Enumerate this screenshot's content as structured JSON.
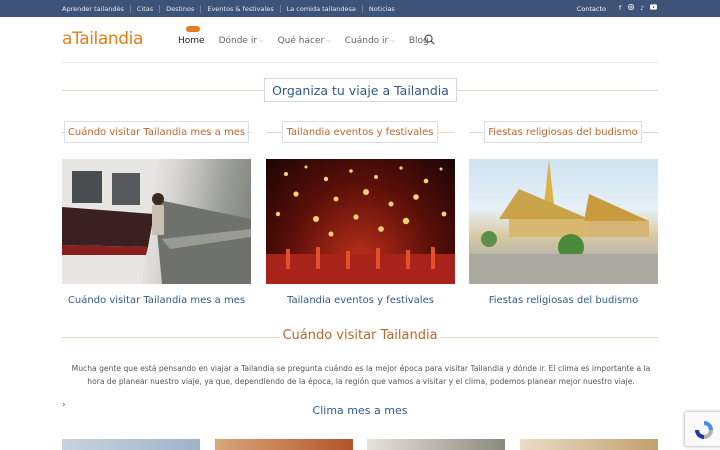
{
  "topbar": {
    "links": [
      "Aprender tailandés",
      "Citas",
      "Destinos",
      "Eventos & festivales",
      "La comida tailandesa",
      "Noticias"
    ],
    "contact": "Contacto",
    "social_icons": [
      "facebook-icon",
      "instagram-icon",
      "tiktok-icon",
      "youtube-icon"
    ]
  },
  "header": {
    "logo": "aTailandia",
    "nav": [
      {
        "label": "Home",
        "dropdown": false,
        "active": true
      },
      {
        "label": "Dónde ir",
        "dropdown": true,
        "active": false
      },
      {
        "label": "Qué hacer",
        "dropdown": true,
        "active": false
      },
      {
        "label": "Cuándo ir",
        "dropdown": true,
        "active": false
      },
      {
        "label": "Blog",
        "dropdown": false,
        "active": false
      }
    ]
  },
  "main": {
    "title": "Organiza tu viaje a Tailandia",
    "categories": [
      {
        "title": "Cuándo visitar Tailandia mes a mes",
        "caption": "Cuándo visitar Tailandia mes a mes"
      },
      {
        "title": "Tailandia eventos y festivales",
        "caption": "Tailandia eventos y festivales"
      },
      {
        "title": "Fiestas religiosas del budismo",
        "caption": "Fiestas religiosas del budismo"
      }
    ],
    "section_title": "Cuándo visitar Tailandia",
    "intro": "Mucha gente que está pensando en viajar a Tailandia se pregunta cuándo es la mejor época para visitar Tailandia y dónde ir. El clima es importante a la hora de planear nuestro viaje, ya que, dependiendo de la época, la región que vamos a visitar y el clima, podemos planear mejor nuestro viaje.",
    "subsection_title": "Clima mes a mes"
  },
  "colors": {
    "topbar": "#3d5378",
    "accent": "#e47d1a",
    "heading_orange": "#c0652a",
    "heading_blue": "#2d5b8a"
  }
}
